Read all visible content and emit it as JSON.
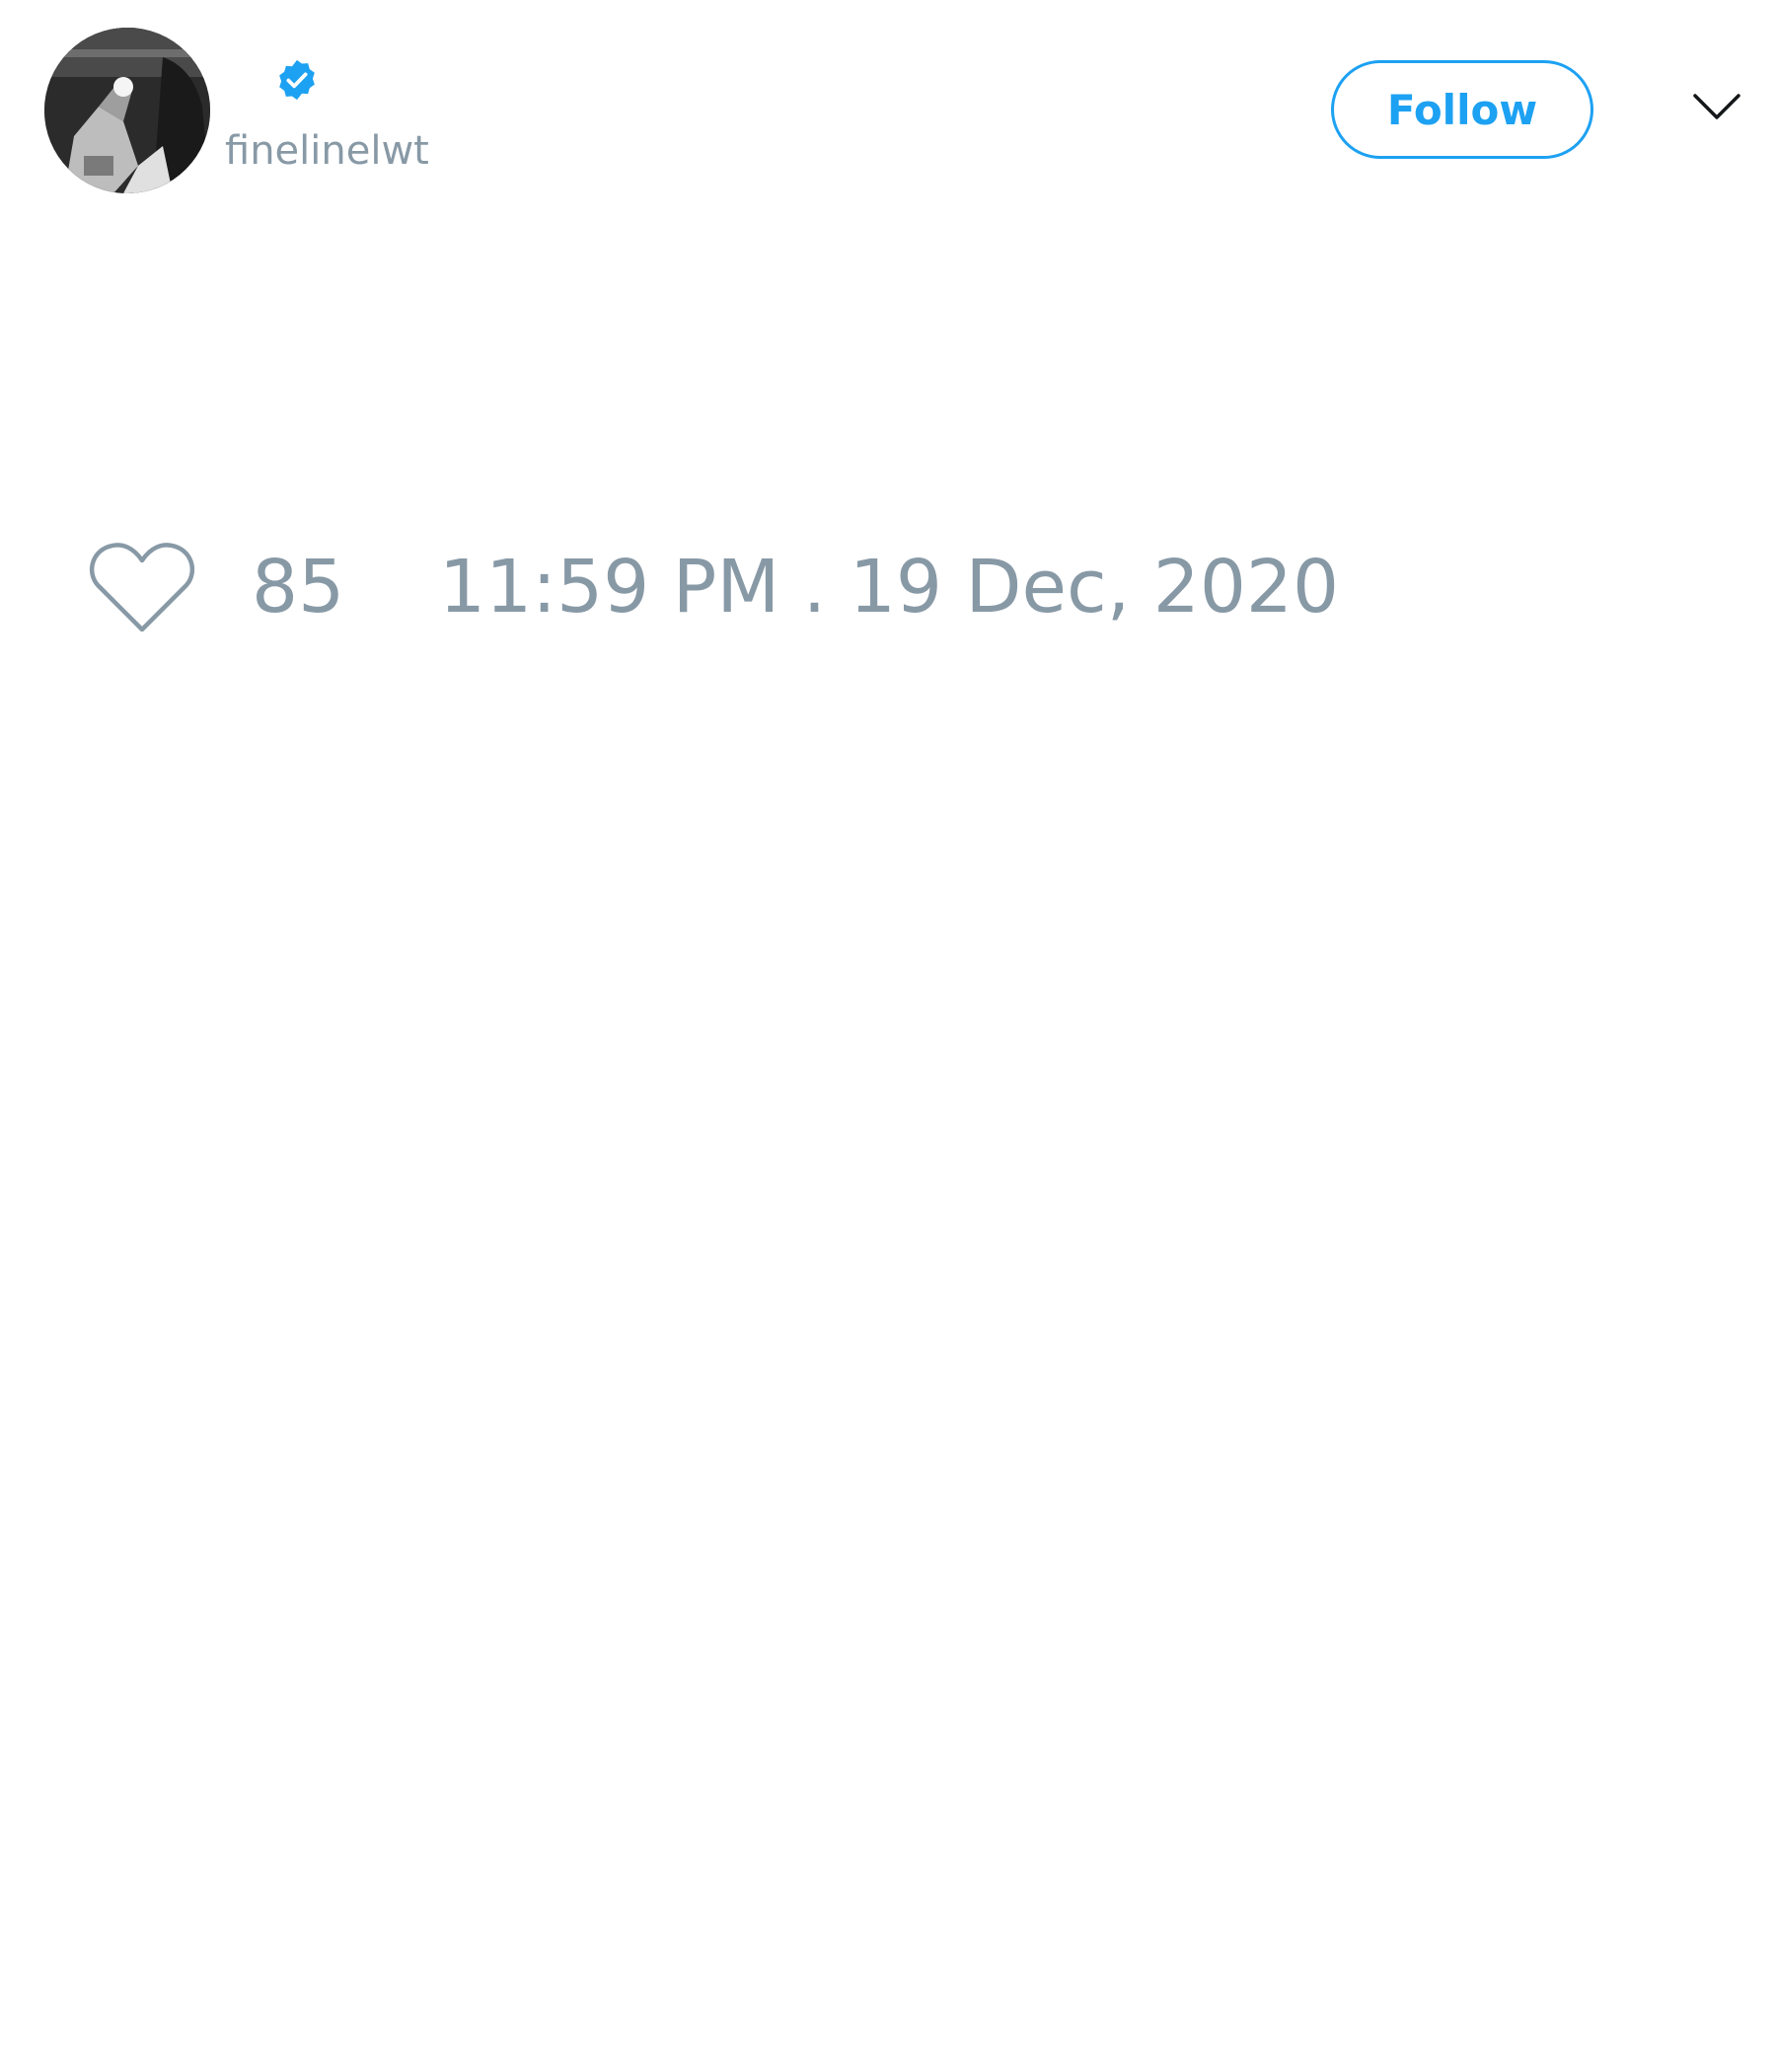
{
  "tweet": {
    "author": {
      "handle": "finelinelwt",
      "verified": true,
      "avatar_icon": "profile-photo"
    },
    "follow_button": {
      "label": "Follow"
    },
    "menu": {
      "icon": "chevron-down-icon"
    },
    "likes": {
      "icon": "heart-icon",
      "count": "85"
    },
    "timestamp": "11:59 PM . 19 Dec, 2020"
  },
  "colors": {
    "accent": "#1da1f2",
    "muted_text": "#8899a6",
    "background": "#ffffff"
  }
}
